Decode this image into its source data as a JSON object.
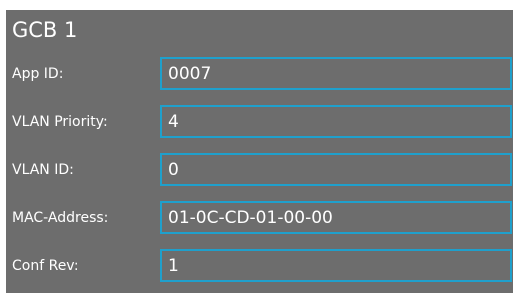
{
  "panel": {
    "title": "GCB 1",
    "fields": [
      {
        "label": "App ID:",
        "value": "0007"
      },
      {
        "label": "VLAN Priority:",
        "value": "4"
      },
      {
        "label": "VLAN ID:",
        "value": "0"
      },
      {
        "label": "MAC-Address:",
        "value": "01-0C-CD-01-00-00"
      },
      {
        "label": "Conf Rev:",
        "value": "1"
      }
    ]
  },
  "colors": {
    "panel_background": "#6d6d6d",
    "field_border": "#1fa0cc",
    "text": "#ffffff"
  }
}
